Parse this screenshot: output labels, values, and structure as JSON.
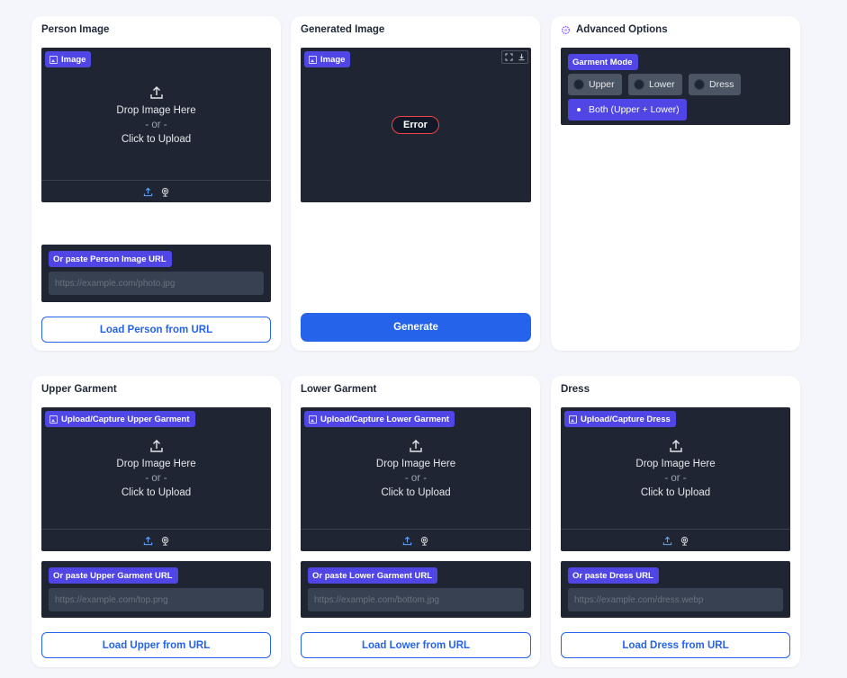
{
  "person": {
    "title": "Person Image",
    "badge": "Image",
    "drop_line1": "Drop Image Here",
    "drop_or": "- or -",
    "drop_line2": "Click to Upload",
    "url_badge": "Or paste Person Image URL",
    "url_placeholder": "https://example.com/photo.jpg",
    "button": "Load Person from URL"
  },
  "generated": {
    "title": "Generated Image",
    "badge": "Image",
    "error": "Error",
    "button": "Generate"
  },
  "advanced": {
    "title": "Advanced Options",
    "garment_mode_label": "Garment Mode",
    "options": [
      "Upper",
      "Lower",
      "Dress",
      "Both (Upper + Lower)"
    ],
    "selected": "Both (Upper + Lower)"
  },
  "upper": {
    "title": "Upper Garment",
    "badge": "Upload/Capture Upper Garment",
    "drop_line1": "Drop Image Here",
    "drop_or": "- or -",
    "drop_line2": "Click to Upload",
    "url_badge": "Or paste Upper Garment URL",
    "url_placeholder": "https://example.com/top.png",
    "button": "Load Upper from URL"
  },
  "lower": {
    "title": "Lower Garment",
    "badge": "Upload/Capture Lower Garment",
    "drop_line1": "Drop Image Here",
    "drop_or": "- or -",
    "drop_line2": "Click to Upload",
    "url_badge": "Or paste Lower Garment URL",
    "url_placeholder": "https://example.com/bottom.jpg",
    "button": "Load Lower from URL"
  },
  "dress": {
    "title": "Dress",
    "badge": "Upload/Capture Dress",
    "drop_line1": "Drop Image Here",
    "drop_or": "- or -",
    "drop_line2": "Click to Upload",
    "url_badge": "Or paste Dress URL",
    "url_placeholder": "https://example.com/dress.webp",
    "button": "Load Dress from URL"
  },
  "colors": {
    "accent": "#4f46e5",
    "primary": "#2563eb",
    "panel": "#1f2532",
    "error": "#ef4444"
  }
}
